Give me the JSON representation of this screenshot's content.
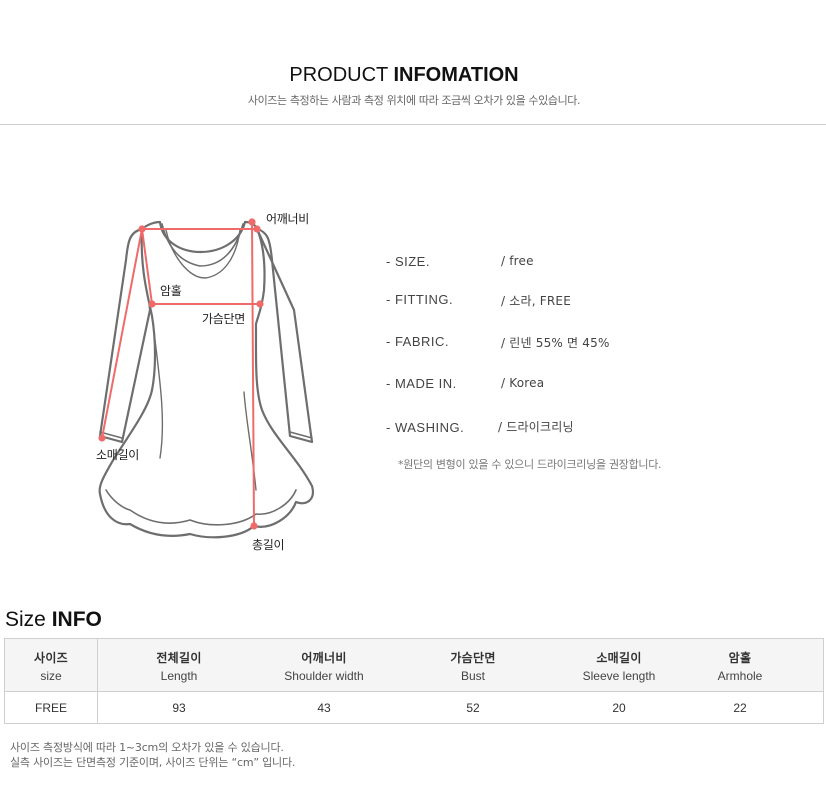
{
  "header": {
    "title_light": "PRODUCT",
    "title_bold": "INFOMATION",
    "subtitle": "사이즈는 측정하는 사람과 측정 위치에 따라 조금씩 오차가 있을 수있습니다."
  },
  "diagram": {
    "labels": {
      "shoulder": "어깨너비",
      "armhole": "암홀",
      "bust": "가슴단면",
      "sleeve": "소매길이",
      "length": "총길이"
    },
    "outline_color": "#6e6e6e",
    "measure_color": "#f06a6a"
  },
  "specs": [
    {
      "key": "- SIZE.",
      "value": "/ free"
    },
    {
      "key": "- FITTING.",
      "value": "/ 소라, FREE"
    },
    {
      "key": "- FABRIC.",
      "value": "/ 린넨 55% 면 45%"
    },
    {
      "key": "- MADE IN.",
      "value": "/ Korea"
    },
    {
      "key": "- WASHING.",
      "value": "/ 드라이크리닝"
    }
  ],
  "spec_note": "*원단의 변형이 있을 수 있으니 드라이크리닝을 권장합니다.",
  "size_info": {
    "title_light": "Size",
    "title_bold": "INFO",
    "columns": [
      {
        "ko": "사이즈",
        "en": "size"
      },
      {
        "ko": "전체길이",
        "en": "Length"
      },
      {
        "ko": "어깨너비",
        "en": "Shoulder  width"
      },
      {
        "ko": "가슴단면",
        "en": "Bust"
      },
      {
        "ko": "소매길이",
        "en": "Sleeve length"
      },
      {
        "ko": "암홀",
        "en": "Armhole"
      }
    ],
    "rows": [
      [
        "FREE",
        "93",
        "43",
        "52",
        "20",
        "22"
      ]
    ]
  },
  "footnotes": [
    "사이즈 측정방식에 따라 1~3cm의 오차가 있을 수 있습니다.",
    "실측 사이즈는 단면측정 기준이며, 사이즈 단위는 “cm” 입니다."
  ]
}
